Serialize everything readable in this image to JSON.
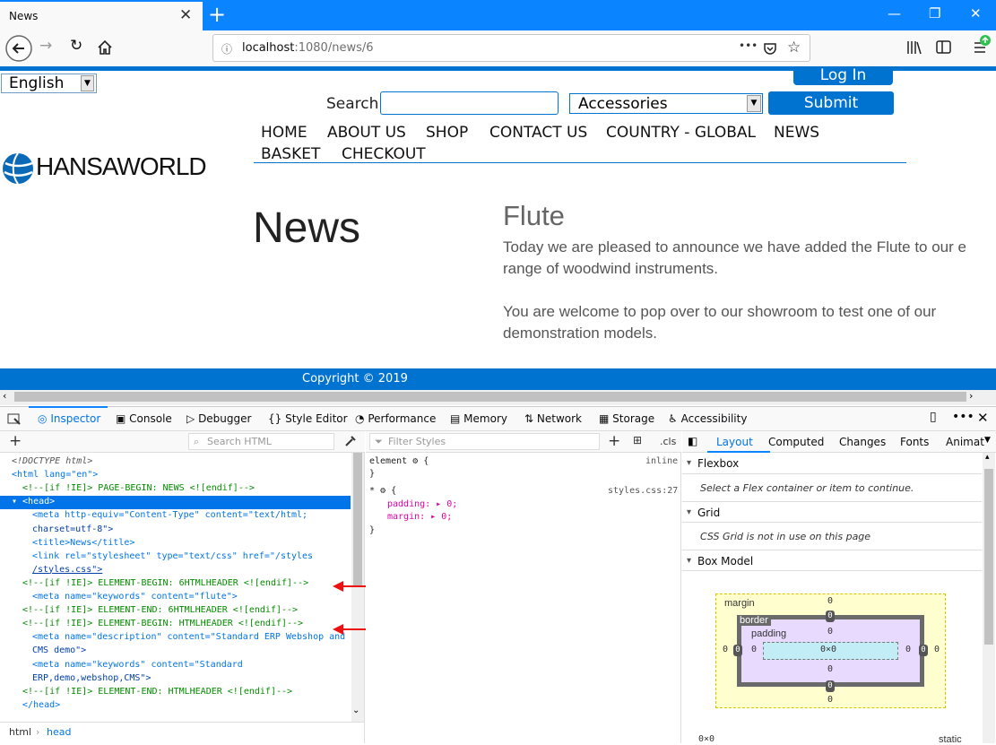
{
  "browser": {
    "tab_title": "News",
    "new_tab": "+",
    "url_host": "localhost",
    "url_path": ":1080/news/6",
    "page_actions": "•••"
  },
  "page": {
    "language": "English",
    "login": "Log In",
    "search_label": "Search",
    "search_value": "",
    "category": "Accessories",
    "submit": "Submit",
    "menu": [
      "HOME",
      "ABOUT US",
      "SHOP",
      "CONTACT US",
      "COUNTRY - GLOBAL",
      "NEWS",
      "BASKET",
      "CHECKOUT"
    ],
    "logo_text": "HANSAWORLD",
    "heading": "News",
    "article_title": "Flute",
    "article_lines": [
      "Today we are pleased to announce we have added the Flute to our e",
      "range of woodwind instruments.",
      "You are welcome to pop over to our showroom to test one of our",
      "demonstration models."
    ],
    "footer": "Copyright © 2019"
  },
  "devtools": {
    "tabs": [
      "Inspector",
      "Console",
      "Debugger",
      "Style Editor",
      "Performance",
      "Memory",
      "Network",
      "Storage",
      "Accessibility"
    ],
    "selected_tab": "Inspector",
    "search_html_placeholder": "Search HTML",
    "filter_styles_placeholder": "Filter Styles",
    "cls_label": ".cls",
    "html_lines": [
      {
        "t": "doctype",
        "text": "<!DOCTYPE html>"
      },
      {
        "t": "html",
        "text": "<html lang=\"en\">"
      },
      {
        "t": "comment",
        "text": "<!--[if !IE]> PAGE-BEGIN: NEWS <![endif]-->"
      },
      {
        "t": "selected",
        "text": "▾ <head>"
      },
      {
        "t": "meta1a",
        "text": "<meta http-equiv=\"Content-Type\" content=\"text/html;"
      },
      {
        "t": "meta1b",
        "text": "charset=utf-8\">"
      },
      {
        "t": "title",
        "text": "<title>News</title>"
      },
      {
        "t": "link",
        "text": "<link rel=\"stylesheet\" type=\"text/css\" href=\"/styles"
      },
      {
        "t": "linkb",
        "text": "/styles.css\">"
      },
      {
        "t": "comment",
        "text": "<!--[if !IE]> ELEMENT-BEGIN: 6HTMLHEADER <![endif]-->"
      },
      {
        "t": "meta",
        "text": "<meta name=\"keywords\" content=\"flute\">"
      },
      {
        "t": "comment",
        "text": "<!--[if !IE]> ELEMENT-END: 6HTMLHEADER <![endif]-->"
      },
      {
        "t": "comment",
        "text": "<!--[if !IE]> ELEMENT-BEGIN: HTMLHEADER <![endif]-->"
      },
      {
        "t": "meta",
        "text": "<meta name=\"description\" content=\"Standard ERP Webshop and"
      },
      {
        "t": "cont",
        "text": "CMS demo\">"
      },
      {
        "t": "meta",
        "text": "<meta name=\"keywords\" content=\"Standard"
      },
      {
        "t": "cont",
        "text": "ERP,demo,webshop,CMS\">"
      },
      {
        "t": "comment",
        "text": "<!--[if !IE]> ELEMENT-END: HTMLHEADER <![endif]-->"
      },
      {
        "t": "close",
        "text": "</head>"
      }
    ],
    "breadcrumb": [
      "html",
      "head"
    ],
    "rules": {
      "element_selector": "element",
      "element_source": "inline",
      "star_selector": "*",
      "star_source": "styles.css:27",
      "padding": "padding: ▸ 0;",
      "margin": "margin: ▸ 0;"
    },
    "layout_tabs": [
      "Layout",
      "Computed",
      "Changes",
      "Fonts",
      "Animat"
    ],
    "selected_layout_tab": "Layout",
    "flexbox_title": "Flexbox",
    "flexbox_hint": "Select a Flex container or item to continue.",
    "grid_title": "Grid",
    "grid_hint": "CSS Grid is not in use on this page",
    "boxmodel_title": "Box Model",
    "box": {
      "margin_label": "margin",
      "border_label": "border",
      "padding_label": "padding",
      "content_size": "0×0",
      "zero": "0",
      "bottom_left": "0×0",
      "bottom_right": "static"
    }
  },
  "colors": {
    "accent": "#0073d1",
    "tabbar": "#0a84ff",
    "annotation_arrow": "#e11111"
  }
}
